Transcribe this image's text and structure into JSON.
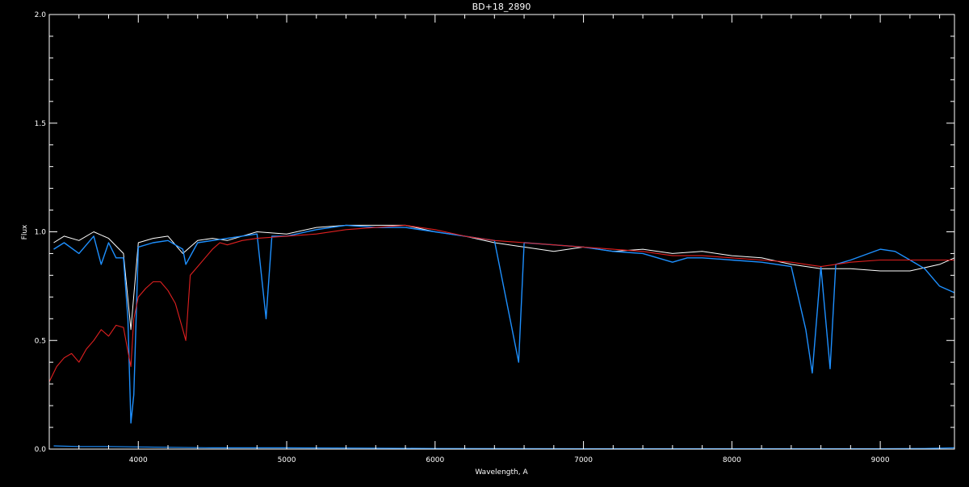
{
  "chart_data": {
    "type": "line",
    "title": "BD+18_2890",
    "xlabel": "Wavelength, A",
    "ylabel": "Flux",
    "xlim": [
      3400,
      9500
    ],
    "ylim": [
      0.0,
      2.0
    ],
    "xticks": [
      4000,
      5000,
      6000,
      7000,
      8000,
      9000
    ],
    "xtick_labels": [
      "4000",
      "5000",
      "6000",
      "7000",
      "8000",
      "9000"
    ],
    "yticks": [
      0.0,
      0.5,
      1.0,
      1.5,
      2.0
    ],
    "ytick_labels": [
      "0.0",
      "0.5",
      "1.0",
      "1.5",
      "2.0"
    ],
    "grid": false,
    "colors": {
      "background": "#000000",
      "axes": "#ffffff",
      "observed": "#1e90ff",
      "reference": "#ffffff",
      "model": "#e02020",
      "error": "#1e90ff"
    },
    "series": [
      {
        "id": "reference",
        "color": "#ffffff",
        "x": [
          3430,
          3500,
          3600,
          3700,
          3800,
          3900,
          3950,
          4000,
          4100,
          4200,
          4300,
          4400,
          4500,
          4600,
          4800,
          5000,
          5200,
          5400,
          5600,
          5800,
          6000,
          6200,
          6400,
          6600,
          6800,
          7000,
          7200,
          7400,
          7600,
          7800,
          8000,
          8200,
          8400,
          8600,
          8800,
          9000,
          9200,
          9400,
          9500
        ],
        "y": [
          0.95,
          0.98,
          0.96,
          1.0,
          0.97,
          0.9,
          0.55,
          0.95,
          0.97,
          0.98,
          0.9,
          0.96,
          0.97,
          0.96,
          1.0,
          0.99,
          1.02,
          1.03,
          1.03,
          1.03,
          1.0,
          0.98,
          0.95,
          0.93,
          0.91,
          0.93,
          0.91,
          0.92,
          0.9,
          0.91,
          0.89,
          0.88,
          0.85,
          0.83,
          0.83,
          0.82,
          0.82,
          0.85,
          0.88
        ]
      },
      {
        "id": "observed",
        "color": "#1e90ff",
        "x": [
          3430,
          3500,
          3600,
          3700,
          3750,
          3800,
          3850,
          3900,
          3930,
          3950,
          3970,
          4000,
          4100,
          4200,
          4300,
          4320,
          4400,
          4500,
          4600,
          4800,
          4861,
          4900,
          5000,
          5200,
          5400,
          5600,
          5800,
          6000,
          6200,
          6400,
          6563,
          6600,
          6800,
          7000,
          7200,
          7400,
          7600,
          7700,
          7800,
          8000,
          8200,
          8400,
          8498,
          8542,
          8600,
          8662,
          8700,
          8800,
          9000,
          9100,
          9200,
          9300,
          9400,
          9500
        ],
        "y": [
          0.92,
          0.95,
          0.9,
          0.98,
          0.85,
          0.95,
          0.88,
          0.88,
          0.6,
          0.12,
          0.25,
          0.93,
          0.95,
          0.96,
          0.92,
          0.85,
          0.95,
          0.96,
          0.97,
          0.99,
          0.6,
          0.98,
          0.98,
          1.01,
          1.03,
          1.02,
          1.02,
          1.0,
          0.98,
          0.96,
          0.4,
          0.95,
          0.94,
          0.93,
          0.91,
          0.9,
          0.86,
          0.88,
          0.88,
          0.87,
          0.86,
          0.84,
          0.55,
          0.35,
          0.84,
          0.37,
          0.85,
          0.87,
          0.92,
          0.91,
          0.87,
          0.83,
          0.75,
          0.72
        ]
      },
      {
        "id": "model",
        "color": "#e02020",
        "x": [
          3400,
          3450,
          3500,
          3550,
          3600,
          3650,
          3700,
          3750,
          3800,
          3850,
          3900,
          3930,
          3950,
          3970,
          4000,
          4050,
          4100,
          4150,
          4200,
          4250,
          4300,
          4320,
          4350,
          4400,
          4450,
          4500,
          4550,
          4600,
          4700,
          4800,
          5000,
          5200,
          5400,
          5600,
          5800,
          6000,
          6200,
          6400,
          6600,
          6800,
          7000,
          7200,
          7400,
          7600,
          7800,
          8000,
          8200,
          8400,
          8500,
          8600,
          8700,
          8800,
          9000,
          9200,
          9400,
          9500
        ],
        "y": [
          0.31,
          0.38,
          0.42,
          0.44,
          0.4,
          0.46,
          0.5,
          0.55,
          0.52,
          0.57,
          0.56,
          0.45,
          0.38,
          0.6,
          0.7,
          0.74,
          0.77,
          0.77,
          0.73,
          0.67,
          0.55,
          0.5,
          0.8,
          0.84,
          0.88,
          0.92,
          0.95,
          0.94,
          0.96,
          0.97,
          0.98,
          0.99,
          1.01,
          1.02,
          1.03,
          1.01,
          0.98,
          0.96,
          0.95,
          0.94,
          0.93,
          0.92,
          0.91,
          0.89,
          0.89,
          0.88,
          0.87,
          0.86,
          0.85,
          0.84,
          0.85,
          0.86,
          0.87,
          0.87,
          0.87,
          0.87
        ]
      },
      {
        "id": "error",
        "color": "#1e90ff",
        "x": [
          3430,
          3600,
          3800,
          4000,
          4500,
          5000,
          5500,
          6000,
          7000,
          8000,
          9000,
          9300,
          9500
        ],
        "y": [
          0.015,
          0.012,
          0.012,
          0.01,
          0.006,
          0.006,
          0.005,
          0.003,
          0.002,
          0.002,
          0.002,
          0.003,
          0.006
        ]
      }
    ]
  }
}
